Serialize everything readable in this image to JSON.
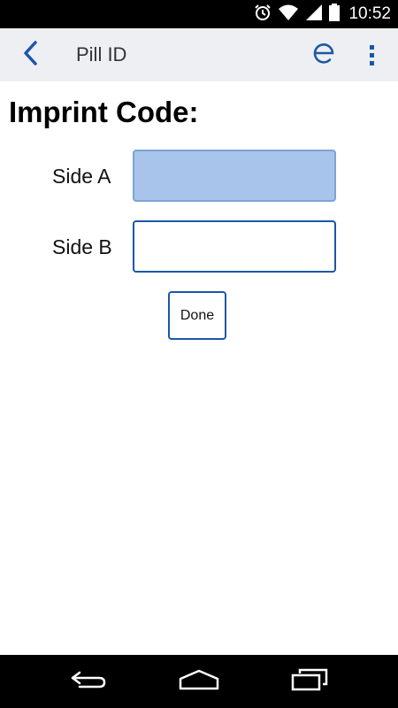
{
  "status_bar": {
    "time": "10:52",
    "icons": [
      "alarm-icon",
      "wifi-icon",
      "signal-icon",
      "battery-icon"
    ]
  },
  "action_bar": {
    "title": "Pill ID",
    "back_icon": "chevron-left-icon",
    "e_label": "e",
    "menu_icon": "overflow-menu-icon"
  },
  "form": {
    "heading": "Imprint Code:",
    "side_a_label": "Side A",
    "side_a_value": "",
    "side_b_label": "Side B",
    "side_b_value": "",
    "done_label": "Done"
  },
  "nav_bar": {
    "icons": [
      "back-icon",
      "home-icon",
      "recents-icon"
    ]
  },
  "colors": {
    "accent": "#1b57a6",
    "field_focus_fill": "#a8c4ea",
    "action_bar_bg": "#eeeff2",
    "system_bar_bg": "#000000"
  }
}
